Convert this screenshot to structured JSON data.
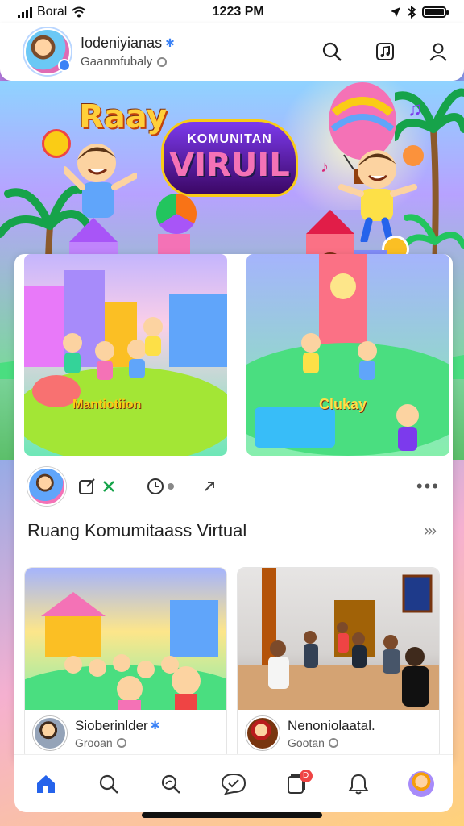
{
  "status_bar": {
    "carrier": "Boral",
    "time": "1223 PM"
  },
  "header": {
    "profile_name": "Iodeniyianas",
    "profile_sub": "Gaanmfubaly",
    "icons": [
      "search-icon",
      "music-note-icon",
      "profile-icon"
    ]
  },
  "hero": {
    "logo_text": "Raay",
    "title_top": "KOMUNITAN",
    "title_main": "VIRUIL",
    "tile_a_label": "Mantiotiion",
    "tile_b_label": "Clukay"
  },
  "post": {
    "actions": [
      "edit-icon",
      "refresh-icon",
      "clock-icon",
      "share-icon"
    ],
    "more_label": "•••",
    "title": "Ruang Komumitaass Virtual",
    "chevron": "›››"
  },
  "cards": [
    {
      "name": "Sioberinlder",
      "sub": "Grooan",
      "verified": true
    },
    {
      "name": "Nenoniolaatal.",
      "sub": "Gootan",
      "verified": false
    }
  ],
  "bottom_nav": {
    "items": [
      "home-icon",
      "search-icon",
      "explore-icon",
      "chat-icon",
      "notifications-icon",
      "alerts-icon",
      "avatar"
    ],
    "badge": "D"
  },
  "colors": {
    "accent": "#3b82f6",
    "badge": "#ef4444"
  }
}
